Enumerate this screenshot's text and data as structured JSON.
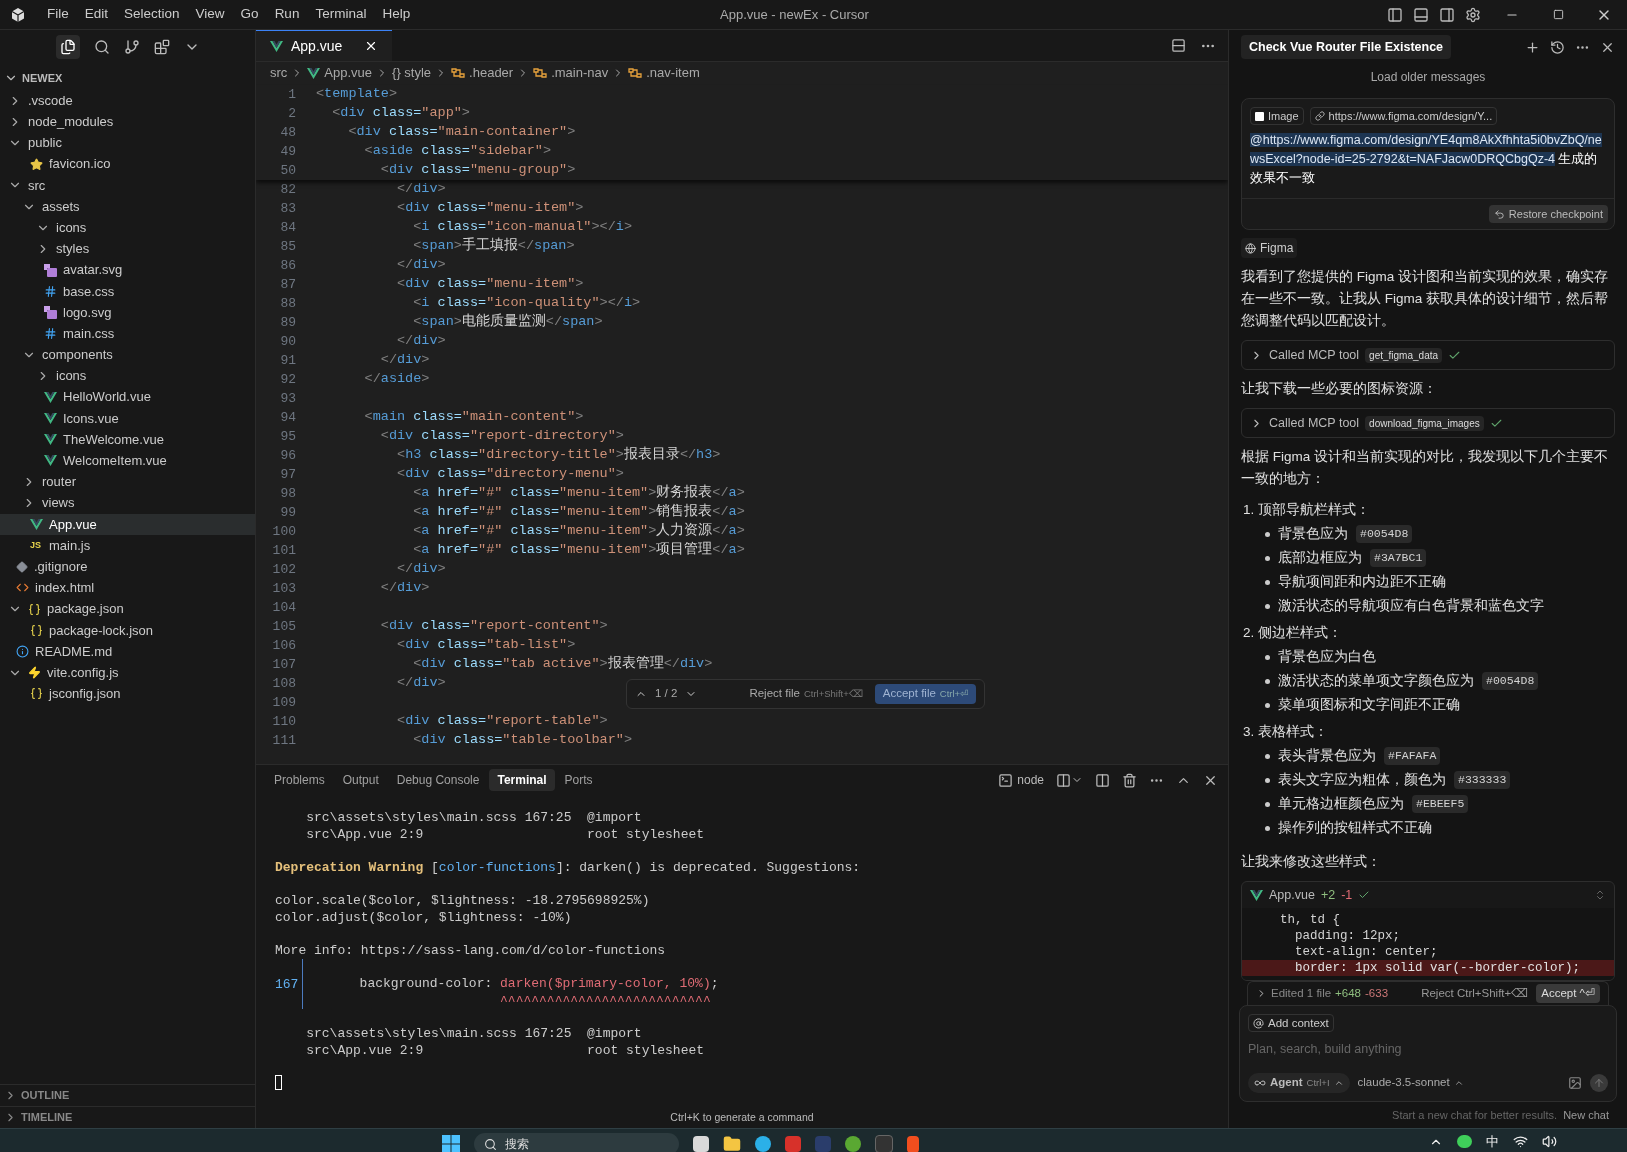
{
  "window": {
    "title": "App.vue - newEx - Cursor",
    "menu": [
      "File",
      "Edit",
      "Selection",
      "View",
      "Go",
      "Run",
      "Terminal",
      "Help"
    ]
  },
  "explorer": {
    "root": "NEWEX",
    "expanded": true,
    "items": [
      {
        "name": ".vscode",
        "kind": "folder",
        "expanded": false
      },
      {
        "name": "node_modules",
        "kind": "folder",
        "expanded": false
      },
      {
        "name": "public",
        "kind": "folder",
        "expanded": true,
        "children": [
          {
            "name": "favicon.ico",
            "kind": "ico"
          }
        ]
      },
      {
        "name": "src",
        "kind": "folder",
        "expanded": true,
        "children": [
          {
            "name": "assets",
            "kind": "folder",
            "expanded": true,
            "children": [
              {
                "name": "icons",
                "kind": "folder",
                "expanded": true
              },
              {
                "name": "styles",
                "kind": "folder",
                "expanded": false
              },
              {
                "name": "avatar.svg",
                "kind": "svg"
              },
              {
                "name": "base.css",
                "kind": "css"
              },
              {
                "name": "logo.svg",
                "kind": "svg"
              },
              {
                "name": "main.css",
                "kind": "css"
              }
            ]
          },
          {
            "name": "components",
            "kind": "folder",
            "expanded": true,
            "children": [
              {
                "name": "icons",
                "kind": "folder",
                "expanded": false
              },
              {
                "name": "HelloWorld.vue",
                "kind": "vue"
              },
              {
                "name": "Icons.vue",
                "kind": "vue"
              },
              {
                "name": "TheWelcome.vue",
                "kind": "vue"
              },
              {
                "name": "WelcomeItem.vue",
                "kind": "vue"
              }
            ]
          },
          {
            "name": "router",
            "kind": "folder",
            "expanded": false
          },
          {
            "name": "views",
            "kind": "folder",
            "expanded": false
          },
          {
            "name": "App.vue",
            "kind": "vue",
            "selected": true
          },
          {
            "name": "main.js",
            "kind": "js",
            "badge": "JS"
          }
        ]
      },
      {
        "name": ".gitignore",
        "kind": "git"
      },
      {
        "name": "index.html",
        "kind": "html"
      },
      {
        "name": "package.json",
        "kind": "json",
        "expanded": true,
        "children": [
          {
            "name": "package-lock.json",
            "kind": "json"
          }
        ]
      },
      {
        "name": "README.md",
        "kind": "md"
      },
      {
        "name": "vite.config.js",
        "kind": "vite",
        "expanded": true,
        "children": [
          {
            "name": "jsconfig.json",
            "kind": "json"
          }
        ]
      }
    ],
    "sections": [
      "OUTLINE",
      "TIMELINE"
    ]
  },
  "editor": {
    "tab": "App.vue",
    "breadcrumbs": [
      {
        "kind": "folder",
        "text": "src"
      },
      {
        "kind": "vue",
        "text": "App.vue"
      },
      {
        "kind": "braces",
        "text": "{} style"
      },
      {
        "kind": "selector",
        "text": ".header"
      },
      {
        "kind": "selector",
        "text": ".main-nav"
      },
      {
        "kind": "selector",
        "text": ".nav-item"
      }
    ],
    "sticky": [
      {
        "n": "1",
        "text": "<template>"
      },
      {
        "n": "2",
        "text": "  <div class=\"app\">"
      },
      {
        "n": "48",
        "text": "    <div class=\"main-container\">"
      },
      {
        "n": "49",
        "text": "      <aside class=\"sidebar\">"
      },
      {
        "n": "50",
        "text": "        <div class=\"menu-group\">"
      }
    ],
    "lines": [
      {
        "n": "82",
        "text": "          </div>"
      },
      {
        "n": "83",
        "text": "          <div class=\"menu-item\">"
      },
      {
        "n": "84",
        "text": "            <i class=\"icon-manual\"></i>"
      },
      {
        "n": "85",
        "text": "            <span>手工填报</span>"
      },
      {
        "n": "86",
        "text": "          </div>"
      },
      {
        "n": "87",
        "text": "          <div class=\"menu-item\">"
      },
      {
        "n": "88",
        "text": "            <i class=\"icon-quality\"></i>"
      },
      {
        "n": "89",
        "text": "            <span>电能质量监测</span>"
      },
      {
        "n": "90",
        "text": "          </div>"
      },
      {
        "n": "91",
        "text": "        </div>"
      },
      {
        "n": "92",
        "text": "      </aside>"
      },
      {
        "n": "93"
      },
      {
        "n": "94",
        "text": "      <main class=\"main-content\">"
      },
      {
        "n": "95",
        "text": "        <div class=\"report-directory\">"
      },
      {
        "n": "96",
        "text": "          <h3 class=\"directory-title\">报表目录</h3>"
      },
      {
        "n": "97",
        "text": "          <div class=\"directory-menu\">"
      },
      {
        "n": "98",
        "text": "            <a href=\"#\" class=\"menu-item\">财务报表</a>"
      },
      {
        "n": "99",
        "text": "            <a href=\"#\" class=\"menu-item\">销售报表</a>"
      },
      {
        "n": "100",
        "text": "            <a href=\"#\" class=\"menu-item\">人力资源</a>"
      },
      {
        "n": "101",
        "text": "            <a href=\"#\" class=\"menu-item\">项目管理</a>"
      },
      {
        "n": "102",
        "text": "          </div>"
      },
      {
        "n": "103",
        "text": "        </div>"
      },
      {
        "n": "104"
      },
      {
        "n": "105",
        "text": "        <div class=\"report-content\">"
      },
      {
        "n": "106",
        "text": "          <div class=\"tab-list\">"
      },
      {
        "n": "107",
        "text": "            <div class=\"tab active\">报表管理</div>"
      },
      {
        "n": "108",
        "text": "          </div>"
      },
      {
        "n": "109"
      },
      {
        "n": "110",
        "text": "          <div class=\"report-table\">"
      },
      {
        "n": "111",
        "text": "            <div class=\"table-toolbar\">"
      }
    ],
    "review": {
      "counter": "1 / 2",
      "reject": "Reject file",
      "reject_keys": "Ctrl+Shift+⌫",
      "accept": "Accept file",
      "accept_keys": "Ctrl+⏎"
    }
  },
  "panel": {
    "tabs": [
      {
        "label": "Problems",
        "selected": false
      },
      {
        "label": "Output",
        "selected": false
      },
      {
        "label": "Debug Console",
        "selected": false
      },
      {
        "label": "Terminal",
        "selected": true
      },
      {
        "label": "Ports",
        "selected": false
      }
    ],
    "shell": "node",
    "lines": [
      {
        "kind": "plain",
        "segments": [
          {
            "kind": "text",
            "text": "    src\\assets\\styles\\main.scss 167:25  @import"
          }
        ]
      },
      {
        "kind": "plain",
        "segments": [
          {
            "kind": "text",
            "text": "    src\\App.vue 2:9                     root stylesheet"
          }
        ]
      },
      {
        "kind": "plain",
        "space_before": true,
        "segments": [
          {
            "kind": "warn",
            "text": "Deprecation Warning"
          },
          {
            "kind": "text",
            "text": " ["
          },
          {
            "kind": "tag",
            "text": "color-functions"
          },
          {
            "kind": "text",
            "text": "]: darken() is deprecated. Suggestions:"
          }
        ]
      },
      {
        "kind": "plain",
        "space_before": true,
        "segments": [
          {
            "kind": "text",
            "text": "color.scale($color, $lightness: -18.2795698925%)"
          }
        ]
      },
      {
        "kind": "plain",
        "segments": [
          {
            "kind": "text",
            "text": "color.adjust($color, $lightness: -10%)"
          }
        ]
      },
      {
        "kind": "plain",
        "space_before": true,
        "segments": [
          {
            "kind": "text",
            "text": "More info: https://sass-lang.com/d/color-functions"
          }
        ]
      },
      {
        "kind": "source",
        "number": "167",
        "space_before": true,
        "segments": [
          {
            "kind": "text",
            "text": "       background-color: "
          },
          {
            "kind": "error",
            "text": "darken($primary-color, 10%)",
            "underline": "^^^^^^^^^^^^^^^^^^^^^^^^^^^"
          },
          {
            "kind": "text",
            "text": ";"
          }
        ]
      },
      {
        "kind": "plain",
        "space_before": true,
        "segments": [
          {
            "kind": "text",
            "text": "    src\\assets\\styles\\main.scss 167:25  @import"
          }
        ]
      },
      {
        "kind": "plain",
        "segments": [
          {
            "kind": "text",
            "text": "    src\\App.vue 2:9                     root stylesheet"
          }
        ]
      }
    ],
    "hint": "Ctrl+K to generate a command"
  },
  "chat": {
    "title": "Check Vue Router File Existence",
    "load_older": "Load older messages",
    "user_message": {
      "chips": [
        {
          "kind": "image",
          "text": "Image"
        },
        {
          "kind": "link",
          "text": "https://www.figma.com/design/Y..."
        }
      ],
      "mention": "@https://www.figma.com/design/YE4qm8AkXfhhta5i0bvZbQ/newsExcel?node-id=25-2792&t=NAFJacw0DRQCbgQz-4",
      "text": " 生成的效果不一致",
      "restore": "Restore checkpoint"
    },
    "source_chip": "Figma",
    "blocks": [
      {
        "kind": "paragraph",
        "text": "我看到了您提供的 Figma 设计图和当前实现的效果，确实存在一些不一致。让我从 Figma 获取具体的设计细节，然后帮您调整代码以匹配设计。"
      },
      {
        "kind": "tool",
        "label": "Called MCP tool",
        "tool": "get_figma_data",
        "done": true
      },
      {
        "kind": "paragraph",
        "text": "让我下载一些必要的图标资源："
      },
      {
        "kind": "tool",
        "label": "Called MCP tool",
        "tool": "download_figma_images",
        "done": true
      },
      {
        "kind": "paragraph",
        "text": "根据 Figma 设计和当前实现的对比，我发现以下几个主要不一致的地方："
      },
      {
        "kind": "list",
        "sections": [
          {
            "number": "1.",
            "title": "顶部导航栏样式：",
            "bullets": [
              {
                "text": "背景色应为",
                "code": "#0054D8"
              },
              {
                "text": "底部边框应为",
                "code": "#3A7BC1"
              },
              {
                "text": "导航项间距和内边距不正确"
              },
              {
                "text": "激活状态的导航项应有白色背景和蓝色文字"
              }
            ]
          },
          {
            "number": "2.",
            "title": "侧边栏样式：",
            "bullets": [
              {
                "text": "背景色应为白色"
              },
              {
                "text": "激活状态的菜单项文字颜色应为",
                "code": "#0054D8"
              },
              {
                "text": "菜单项图标和文字间距不正确"
              }
            ]
          },
          {
            "number": "3.",
            "title": "表格样式：",
            "bullets": [
              {
                "text": "表头背景色应为",
                "code": "#FAFAFA"
              },
              {
                "text": "表头文字应为粗体，颜色为",
                "code": "#333333"
              },
              {
                "text": "单元格边框颜色应为",
                "code": "#EBEEF5"
              },
              {
                "text": "操作列的按钮样式不正确"
              }
            ]
          }
        ]
      },
      {
        "kind": "paragraph",
        "text": "让我来修改这些样式："
      },
      {
        "kind": "diff",
        "file": "App.vue",
        "added": "+2",
        "removed": "-1",
        "done": true,
        "lines": [
          {
            "kind": "context",
            "text": "th, td {"
          },
          {
            "kind": "context",
            "text": "  padding: 12px;"
          },
          {
            "kind": "context",
            "text": "  text-align: center;"
          },
          {
            "kind": "removed",
            "text": "  border: 1px solid var(--border-color);"
          }
        ]
      }
    ],
    "edited": {
      "label": "Edited 1 file",
      "added": "+648",
      "removed": "-633",
      "reject": "Reject Ctrl+Shift+⌫",
      "accept": "Accept ^⏎"
    },
    "composer": {
      "context": "Add context",
      "placeholder": "Plan, search, build anything",
      "mode": "Agent",
      "mode_keys": "Ctrl+I",
      "model": "claude-3.5-sonnet"
    },
    "footer": {
      "text": "Start a new chat for better results.",
      "link": "New chat"
    }
  },
  "taskbar": {
    "search_placeholder": "搜索",
    "input_method": "中"
  }
}
